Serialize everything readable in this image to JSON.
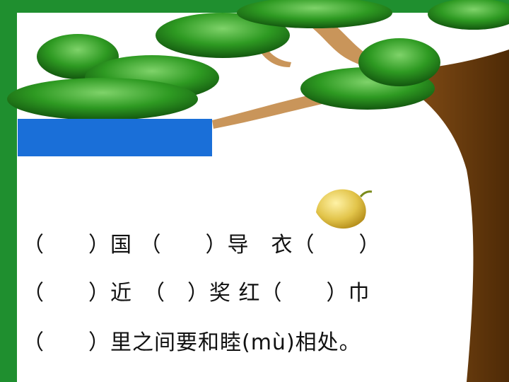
{
  "exercise": {
    "line1": "（　　）国 （　　）导　衣（　　）",
    "line2": "（　　）近　（　）奖 红（　　）巾",
    "line3": "（　　）里之间要和睦(mù)相处。"
  },
  "colors": {
    "frame_green": "#1f8f2f",
    "leaf_green": "#2e8b1e",
    "trunk_brown": "#6b3d0c",
    "branch_tan": "#c9955a",
    "label_blue": "#1a6fd8"
  }
}
